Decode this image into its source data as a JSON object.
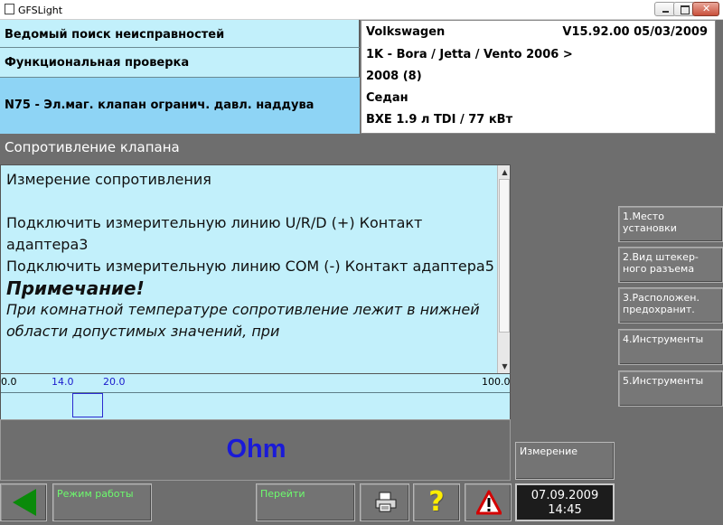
{
  "window": {
    "title": "GFSLight"
  },
  "header": {
    "row1": "Ведомый поиск неисправностей",
    "row2": "Функциональная проверка",
    "row3": "N75 - Эл.маг. клапан огранич. давл. наддува"
  },
  "vehicle": {
    "make": "Volkswagen",
    "version": "V15.92.00 05/03/2009",
    "model_line1": "1K - Bora / Jetta / Vento 2006 >",
    "model_line2": "2008 (8)",
    "body": "Седан",
    "engine": "BXE 1.9 л TDI / 77 кВт"
  },
  "section_title": "Сопротивление клапана",
  "text": {
    "line1": "Измерение сопротивления",
    "line2": "Подключить измерительную линию U/R/D (+) Контакт адаптера3",
    "line3": "Подключить измерительную линию COM (-) Контакт адаптера5",
    "note_title": "Примечание!",
    "note_body": " При комнатной температуре сопротивление лежит в нижней области допустимых значений, при"
  },
  "scale": {
    "min_label": "0.0",
    "low_label": "14.0",
    "high_label": "20.0",
    "max_label": "100.0",
    "min": 0.0,
    "max": 100.0,
    "range_low": 14.0,
    "range_high": 20.0
  },
  "unit": "Ohm",
  "side_buttons": [
    {
      "label": "1.Место установки"
    },
    {
      "label": "2.Вид штекер-ного разъема"
    },
    {
      "label": "3.Расположен. предохранит."
    },
    {
      "label": "4.Инструменты"
    },
    {
      "label": "5.Инструменты"
    }
  ],
  "measure_label": "Измерение",
  "toolbar": {
    "mode_label": "Режим работы",
    "goto_label": "Перейти",
    "help_glyph": "?"
  },
  "datetime": {
    "date": "07.09.2009",
    "time": "14:45"
  },
  "colors": {
    "panel": "#c2f0fb",
    "highlight": "#8ed4f5",
    "background": "#6e6e6e",
    "unit_text": "#1a1ad8",
    "button_text": "#6dfb6d"
  }
}
